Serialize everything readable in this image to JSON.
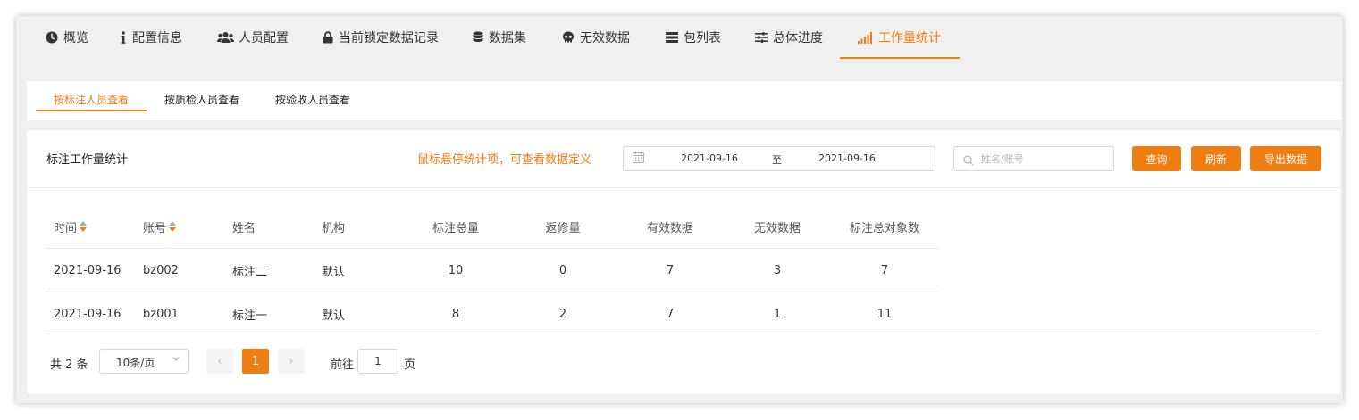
{
  "top_tabs": [
    {
      "label": "概览",
      "icon": "clock-icon"
    },
    {
      "label": "配置信息",
      "icon": "info-icon"
    },
    {
      "label": "人员配置",
      "icon": "users-icon"
    },
    {
      "label": "当前锁定数据记录",
      "icon": "lock-icon"
    },
    {
      "label": "数据集",
      "icon": "database-icon"
    },
    {
      "label": "无效数据",
      "icon": "skull-icon"
    },
    {
      "label": "包列表",
      "icon": "list-icon"
    },
    {
      "label": "总体进度",
      "icon": "sliders-icon"
    },
    {
      "label": "工作量统计",
      "icon": "signal-bars-icon",
      "active": true
    }
  ],
  "sub_tabs": [
    {
      "label": "按标注人员查看",
      "active": true
    },
    {
      "label": "按质检人员查看"
    },
    {
      "label": "按验收人员查看"
    }
  ],
  "card": {
    "title": "标注工作量统计",
    "hint": "鼠标悬停统计项，可查看数据定义",
    "date_start": "2021-09-16",
    "date_sep": "至",
    "date_end": "2021-09-16",
    "search_placeholder": "姓名/账号",
    "buttons": {
      "query": "查询",
      "refresh": "刷新",
      "export": "导出数据"
    }
  },
  "table": {
    "columns": [
      "时间",
      "账号",
      "姓名",
      "机构",
      "标注总量",
      "返修量",
      "有效数据",
      "无效数据",
      "标注总对象数"
    ],
    "rows": [
      [
        "2021-09-16",
        "bz002",
        "标注二",
        "默认",
        "10",
        "0",
        "7",
        "3",
        "7"
      ],
      [
        "2021-09-16",
        "bz001",
        "标注一",
        "默认",
        "8",
        "2",
        "7",
        "1",
        "11"
      ]
    ]
  },
  "pagination": {
    "total": "共 2 条",
    "page_size": "10条/页",
    "prev": "‹",
    "current": "1",
    "next": "›",
    "goto_label": "前往",
    "goto_value": "1",
    "page_suffix": "页"
  },
  "colors": {
    "accent": "#ee7d12"
  }
}
